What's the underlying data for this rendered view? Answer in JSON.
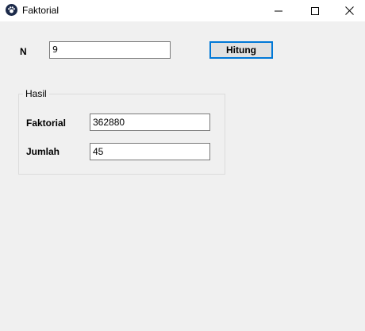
{
  "window": {
    "title": "Faktorial",
    "icon": "paw-icon",
    "controls": [
      "minimize-icon",
      "maximize-icon",
      "close-icon"
    ]
  },
  "input": {
    "label": "N",
    "value": "9"
  },
  "button": {
    "label": "Hitung"
  },
  "group": {
    "legend": "Hasil",
    "faktorial_label": "Faktorial",
    "faktorial_value": "362880",
    "jumlah_label": "Jumlah",
    "jumlah_value": "45"
  },
  "colors": {
    "focus_border": "#0078d7",
    "background": "#f0f0f0"
  }
}
